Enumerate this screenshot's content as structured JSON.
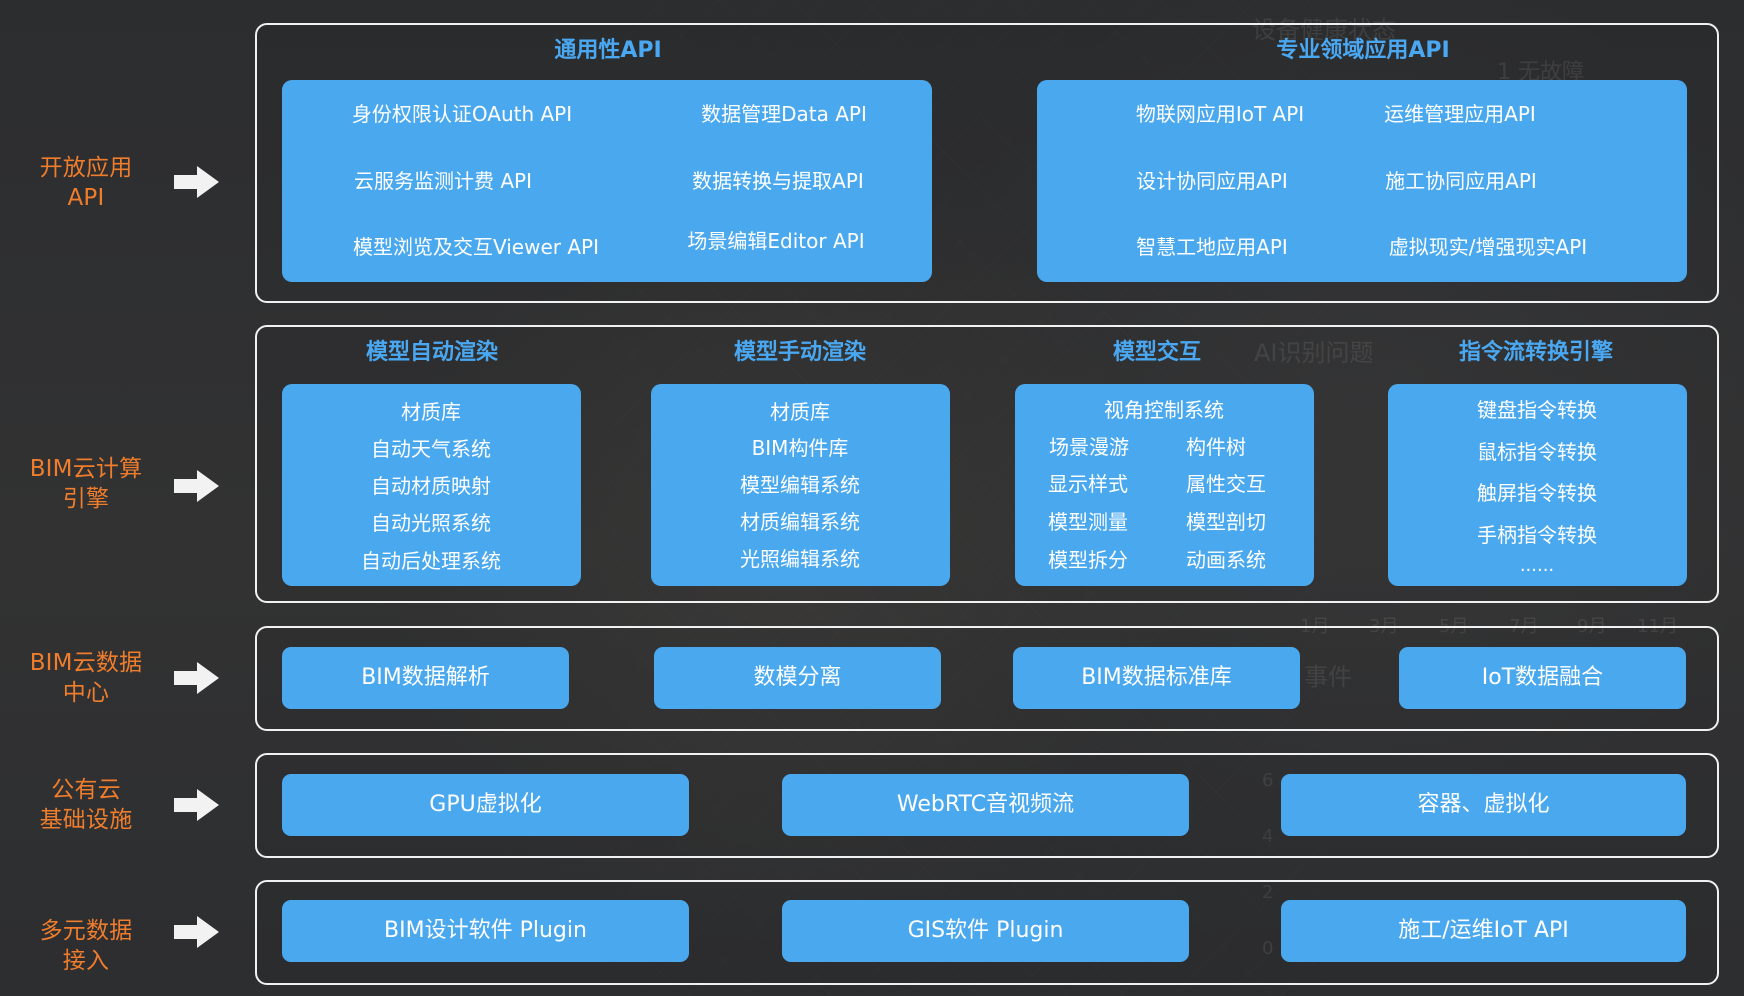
{
  "rows": [
    {
      "label_line1": "开放应用",
      "label_line2": "API"
    },
    {
      "label_line1": "BIM云计算",
      "label_line2": "引擎"
    },
    {
      "label_line1": "BIM云数据",
      "label_line2": "中心"
    },
    {
      "label_line1": "公有云",
      "label_line2": "基础设施"
    },
    {
      "label_line1": "多元数据",
      "label_line2": "接入"
    }
  ],
  "open_api": {
    "left_title": "通用性API",
    "right_title": "专业领域应用API",
    "left_items": [
      "身份权限认证OAuth API",
      "数据管理Data API",
      "云服务监测计费 API",
      "数据转换与提取API",
      "模型浏览及交互Viewer API",
      "场景编辑Editor API"
    ],
    "right_items": [
      "物联网应用IoT API",
      "运维管理应用API",
      "设计协同应用API",
      "施工协同应用API",
      "智慧工地应用API",
      "虚拟现实/增强现实API"
    ]
  },
  "engine": {
    "columns": [
      {
        "title": "模型自动渲染",
        "items": [
          "材质库",
          "自动天气系统",
          "自动材质映射",
          "自动光照系统",
          "自动后处理系统"
        ]
      },
      {
        "title": "模型手动渲染",
        "items": [
          "材质库",
          "BIM构件库",
          "模型编辑系统",
          "材质编辑系统",
          "光照编辑系统"
        ]
      },
      {
        "title": "模型交互",
        "header": "视角控制系统",
        "left_items": [
          "场景漫游",
          "显示样式",
          "模型测量",
          "模型拆分"
        ],
        "right_items": [
          "构件树",
          "属性交互",
          "模型剖切",
          "动画系统"
        ]
      },
      {
        "title": "指令流转换引擎",
        "items": [
          "键盘指令转换",
          "鼠标指令转换",
          "触屏指令转换",
          "手柄指令转换",
          "......"
        ]
      }
    ]
  },
  "data_center": {
    "items": [
      "BIM数据解析",
      "数模分离",
      "BIM数据标准库",
      "IoT数据融合"
    ]
  },
  "public_cloud": {
    "items": [
      "GPU虚拟化",
      "WebRTC音视频流",
      "容器、虚拟化"
    ]
  },
  "data_access": {
    "items": [
      "BIM设计软件 Plugin",
      "GIS软件 Plugin",
      "施工/运维IoT API"
    ]
  },
  "background_text": {
    "status_title": "设备健康状态",
    "fault_free": "1 无故障",
    "ai_issue": "AI识别问题",
    "event": "事件",
    "months": [
      "1月",
      "3月",
      "5月",
      "7月",
      "9月",
      "11月"
    ],
    "axis_values": [
      "6",
      "4",
      "2",
      "0"
    ]
  },
  "colors": {
    "accent_orange": "#ef7d2c",
    "card_blue": "#4aa8ef",
    "title_blue": "#4aa8f2"
  },
  "icons": {
    "row_arrow": "right-arrow-icon"
  }
}
